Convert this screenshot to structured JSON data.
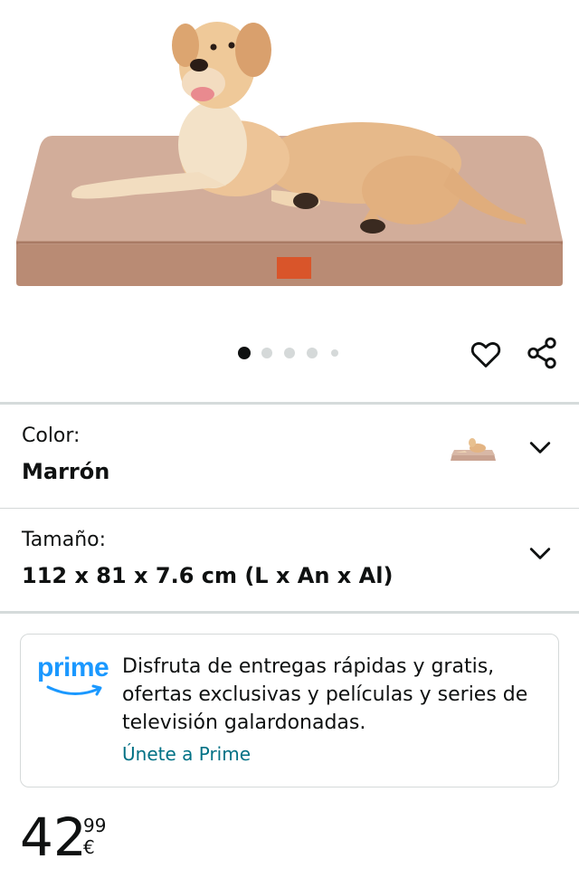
{
  "gallery": {
    "image_alt": "Cama ortopédica para perro color marrón con labrador",
    "total_images": 5,
    "active_index": 0
  },
  "actions": {
    "favorite_icon": "heart-icon",
    "share_icon": "share-icon"
  },
  "variations": {
    "color": {
      "label": "Color:",
      "value": "Marrón"
    },
    "size": {
      "label": "Tamaño:",
      "value": "112 x 81 x 7.6 cm (L x An x Al)"
    }
  },
  "prime": {
    "logo_text": "prime",
    "message": "Disfruta de entregas rápidas y gratis, ofertas exclusivas y películas y series de televisión galardonadas.",
    "link": "Únete a Prime"
  },
  "price": {
    "whole": "42",
    "fraction": "99 €"
  },
  "colors": {
    "link": "#007185",
    "prime_blue": "#1a98ff",
    "bed_tan": "#c9a391",
    "divider": "#d5d9d9"
  }
}
